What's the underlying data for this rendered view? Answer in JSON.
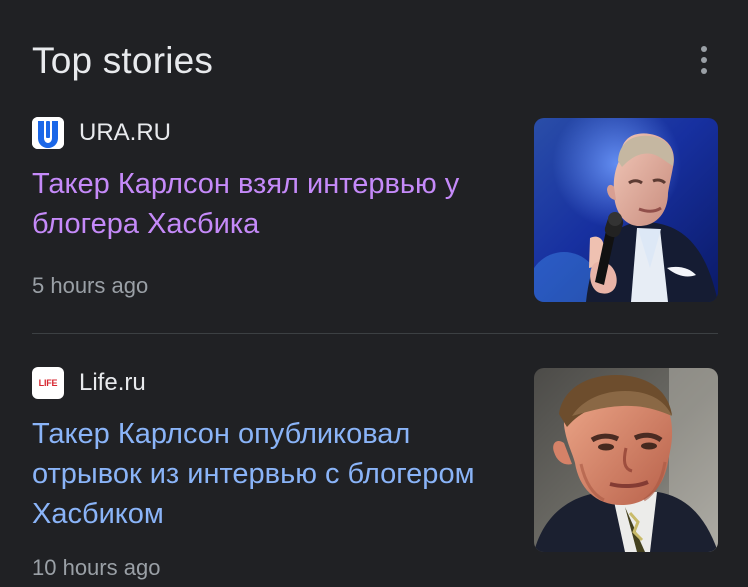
{
  "section": {
    "title": "Top stories"
  },
  "stories": [
    {
      "source": "URA.RU",
      "headline": "Такер Карлсон взял интервью у блогера Хасбика",
      "time": "5 hours ago"
    },
    {
      "source": "Life.ru",
      "logo_text": "LIFE",
      "headline": "Такер Карлсон опубликовал отрывок из интервью с блогером Хасбиком",
      "time": "10 hours ago"
    }
  ],
  "colors": {
    "background": "#202124",
    "visited_link": "#c58af9",
    "link": "#8ab4f8",
    "muted": "#9aa0a6"
  }
}
